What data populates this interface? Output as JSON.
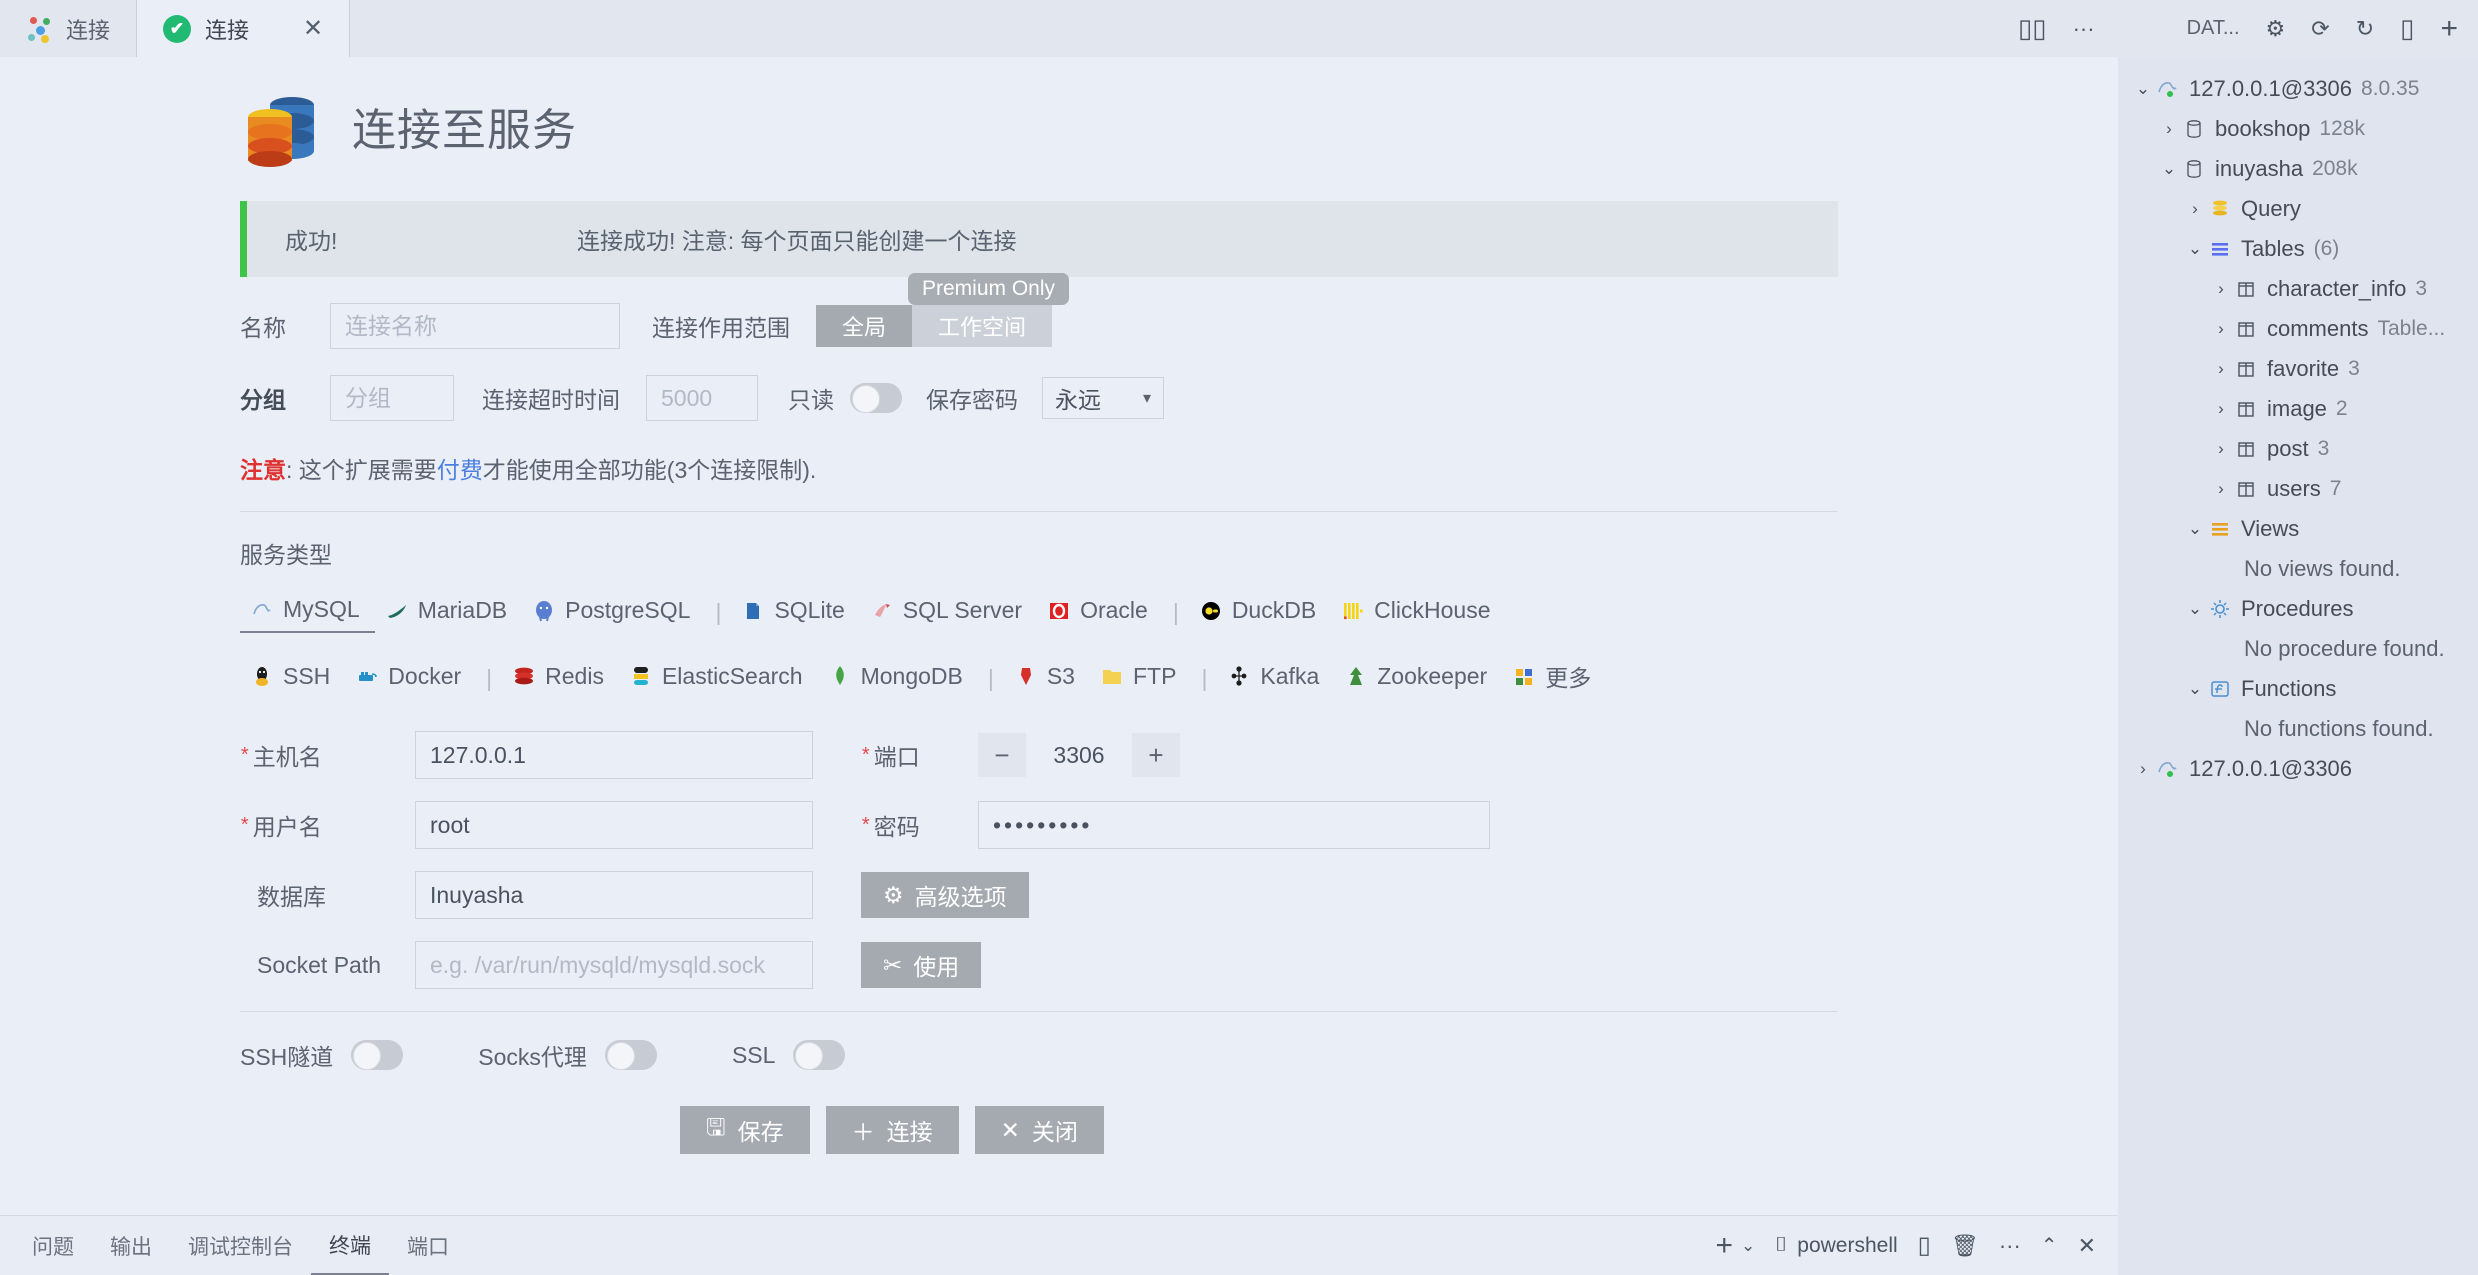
{
  "tabs": [
    {
      "label": "连接",
      "icon": "dots-icon",
      "active": false
    },
    {
      "label": "连接",
      "icon": "check-circle-icon",
      "active": true,
      "close": "✕"
    }
  ],
  "titlebar_right": {
    "split_label": "split-editor-icon",
    "more_label": "···",
    "db_label": "DAT...",
    "gear": "gear-icon",
    "history": "history-icon",
    "refresh": "refresh-icon",
    "split": "split-icon",
    "add": "add-icon"
  },
  "page": {
    "title": "连接至服务",
    "alert": {
      "title": "成功!",
      "message": "连接成功! 注意: 每个页面只能创建一个连接"
    }
  },
  "form": {
    "name_label": "名称",
    "name_placeholder": "连接名称",
    "name_value": "",
    "scope_label": "连接作用范围",
    "scope_global": "全局",
    "scope_workspace": "工作空间",
    "tooltip": "Premium Only",
    "group_label": "分组",
    "group_placeholder": "分组",
    "group_value": "",
    "timeout_label": "连接超时时间",
    "timeout_placeholder": "5000",
    "timeout_value": "",
    "readonly_label": "只读",
    "savepwd_label": "保存密码",
    "savepwd_value": "永远"
  },
  "note": {
    "prefix": "注意",
    "mid1": ": 这个扩展需要",
    "link": "付费",
    "mid2": "才能使用全部功能(3个连接限制)."
  },
  "service": {
    "label": "服务类型",
    "row1": [
      {
        "name": "MySQL",
        "icon": "mysql-icon",
        "selected": true
      },
      {
        "name": "MariaDB",
        "icon": "mariadb-icon",
        "selected": false
      },
      {
        "name": "PostgreSQL",
        "icon": "postgresql-icon",
        "selected": false
      },
      {
        "sep": "|"
      },
      {
        "name": "SQLite",
        "icon": "sqlite-icon",
        "selected": false
      },
      {
        "name": "SQL Server",
        "icon": "sqlserver-icon",
        "selected": false
      },
      {
        "name": "Oracle",
        "icon": "oracle-icon",
        "selected": false
      },
      {
        "sep": "|"
      },
      {
        "name": "DuckDB",
        "icon": "duckdb-icon",
        "selected": false
      },
      {
        "name": "ClickHouse",
        "icon": "clickhouse-icon",
        "selected": false
      }
    ],
    "row2": [
      {
        "name": "SSH",
        "icon": "ssh-icon",
        "selected": false
      },
      {
        "name": "Docker",
        "icon": "docker-icon",
        "selected": false
      },
      {
        "sep": "|"
      },
      {
        "name": "Redis",
        "icon": "redis-icon",
        "selected": false
      },
      {
        "name": "ElasticSearch",
        "icon": "elasticsearch-icon",
        "selected": false
      },
      {
        "name": "MongoDB",
        "icon": "mongodb-icon",
        "selected": false
      },
      {
        "sep": "|"
      },
      {
        "name": "S3",
        "icon": "s3-icon",
        "selected": false
      },
      {
        "name": "FTP",
        "icon": "ftp-icon",
        "selected": false
      },
      {
        "sep": "|"
      },
      {
        "name": "Kafka",
        "icon": "kafka-icon",
        "selected": false
      },
      {
        "name": "Zookeeper",
        "icon": "zookeeper-icon",
        "selected": false
      },
      {
        "name": "更多",
        "icon": "more-icon",
        "selected": false
      }
    ]
  },
  "conn": {
    "host_label": "主机名",
    "host_value": "127.0.0.1",
    "port_label": "端口",
    "port_value": "3306",
    "port_minus": "−",
    "port_plus": "+",
    "user_label": "用户名",
    "user_value": "root",
    "pwd_label": "密码",
    "pwd_value": "•••••••••",
    "db_label": "数据库",
    "db_value": "Inuyasha",
    "socket_label": "Socket Path",
    "socket_placeholder": "e.g. /var/run/mysqld/mysqld.sock",
    "socket_value": "",
    "advanced_btn": "高级选项",
    "use_btn": "使用"
  },
  "toggles": {
    "ssh_tunnel": "SSH隧道",
    "socks_proxy": "Socks代理",
    "ssl": "SSL"
  },
  "actions": {
    "save": "保存",
    "connect": "连接",
    "close": "关闭"
  },
  "sidebar": {
    "nodes": [
      {
        "depth": 0,
        "arrow": "⌄",
        "icon": "mysql-conn-icon",
        "label": "127.0.0.1@3306",
        "meta": "8.0.35"
      },
      {
        "depth": 1,
        "arrow": "›",
        "icon": "database-icon",
        "label": "bookshop",
        "meta": "128k"
      },
      {
        "depth": 1,
        "arrow": "⌄",
        "icon": "database-icon",
        "label": "inuyasha",
        "meta": "208k"
      },
      {
        "depth": 2,
        "arrow": "›",
        "icon": "query-icon",
        "label": "Query",
        "meta": ""
      },
      {
        "depth": 2,
        "arrow": "⌄",
        "icon": "tables-icon",
        "label": "Tables",
        "meta": "(6)"
      },
      {
        "depth": 3,
        "arrow": "›",
        "icon": "table-icon",
        "label": "character_info",
        "meta": "3"
      },
      {
        "depth": 3,
        "arrow": "›",
        "icon": "table-icon",
        "label": "comments",
        "meta": "Table..."
      },
      {
        "depth": 3,
        "arrow": "›",
        "icon": "table-icon",
        "label": "favorite",
        "meta": "3"
      },
      {
        "depth": 3,
        "arrow": "›",
        "icon": "table-icon",
        "label": "image",
        "meta": "2"
      },
      {
        "depth": 3,
        "arrow": "›",
        "icon": "table-icon",
        "label": "post",
        "meta": "3"
      },
      {
        "depth": 3,
        "arrow": "›",
        "icon": "table-icon",
        "label": "users",
        "meta": "7"
      },
      {
        "depth": 2,
        "arrow": "⌄",
        "icon": "views-icon",
        "label": "Views",
        "meta": ""
      },
      {
        "depth": 3,
        "arrow": "",
        "icon": "",
        "label": "No views found.",
        "meta": ""
      },
      {
        "depth": 2,
        "arrow": "⌄",
        "icon": "procedures-icon",
        "label": "Procedures",
        "meta": ""
      },
      {
        "depth": 3,
        "arrow": "",
        "icon": "",
        "label": "No procedure found.",
        "meta": ""
      },
      {
        "depth": 2,
        "arrow": "⌄",
        "icon": "functions-icon",
        "label": "Functions",
        "meta": ""
      },
      {
        "depth": 3,
        "arrow": "",
        "icon": "",
        "label": "No functions found.",
        "meta": ""
      },
      {
        "depth": 0,
        "arrow": "›",
        "icon": "mysql-conn-icon",
        "label": "127.0.0.1@3306",
        "meta": ""
      }
    ]
  },
  "bottom": {
    "tabs": [
      {
        "label": "问题",
        "active": false
      },
      {
        "label": "输出",
        "active": false
      },
      {
        "label": "调试控制台",
        "active": false
      },
      {
        "label": "终端",
        "active": true
      },
      {
        "label": "端口",
        "active": false
      }
    ],
    "shell": "powershell",
    "add": "+",
    "chev": "⌄",
    "split": "split-terminal-icon",
    "trash": "trash-icon",
    "more": "···",
    "collapse": "⌃",
    "close": "✕"
  }
}
